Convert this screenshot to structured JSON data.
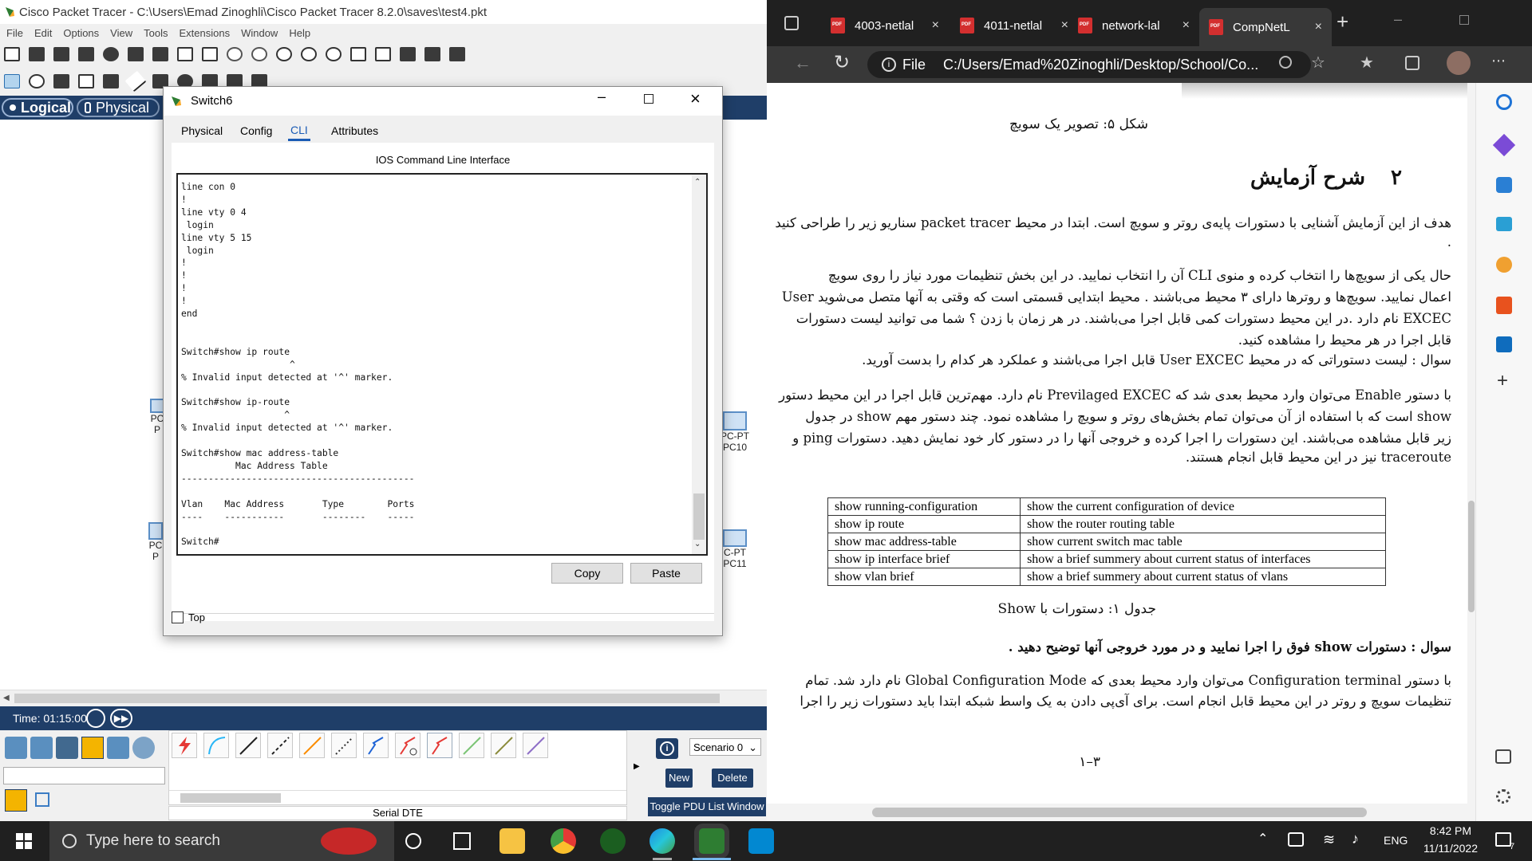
{
  "pt": {
    "title": "Cisco Packet Tracer - C:\\Users\\Emad Zinoghli\\Cisco Packet Tracer 8.2.0\\saves\\test4.pkt",
    "menu": [
      "File",
      "Edit",
      "Options",
      "View",
      "Tools",
      "Extensions",
      "Window",
      "Help"
    ],
    "view_tabs": {
      "logical": "Logical",
      "physical": "Physical"
    },
    "time_label": "Time: 01:15:00",
    "scenario": "Scenario 0",
    "new_button": "New",
    "delete_button": "Delete",
    "toggle_pdu": "Toggle PDU List Window",
    "connection_label": "Serial DTE",
    "devices": [
      {
        "label1": "PC",
        "label2": "P"
      },
      {
        "label1": "PC-PT",
        "label2": "PC10"
      },
      {
        "label1": "PC",
        "label2": "P"
      },
      {
        "label1": "C-PT",
        "label2": "PC11"
      }
    ]
  },
  "dialog": {
    "title": "Switch6",
    "tabs": [
      "Physical",
      "Config",
      "CLI",
      "Attributes"
    ],
    "active_tab": "CLI",
    "heading": "IOS Command Line Interface",
    "cli_text": "line con 0\n!\nline vty 0 4\n login\nline vty 5 15\n login\n!\n!\n!\n!\nend\n\n\nSwitch#show ip route\n                    ^\n% Invalid input detected at '^' marker.\n\nSwitch#show ip-route\n                   ^\n% Invalid input detected at '^' marker.\n\nSwitch#show mac address-table\n          Mac Address Table\n-------------------------------------------\n\nVlan    Mac Address       Type        Ports\n----    -----------       --------    -----\n\nSwitch#",
    "copy": "Copy",
    "paste": "Paste",
    "top_label": "Top"
  },
  "edge": {
    "tabs": [
      {
        "label": "4003-netlal"
      },
      {
        "label": "4011-netlal"
      },
      {
        "label": "network-lal"
      },
      {
        "label": "CompNetL"
      }
    ],
    "url_scheme": "File",
    "url": "C:/Users/Emad%20Zinoghli/Desktop/School/Co...",
    "pdf": {
      "figure_caption": "شکل ۵: تصویر یک سویچ",
      "section_number": "۲",
      "section_title": "شرح آزمایش",
      "p1_line1": "هدف از این آزمایش آشنایی با دستورات پایه‌ی روتر و سویچ است. ابتدا در محیط packet tracer سناریو زیر را طراحی کنید",
      "p1_line2": ".",
      "p2_line1": "حال یکی از سویچ‌ها را انتخاب کرده و منوی CLI آن را انتخاب نمایید.  در این بخش تنظیمات مورد نیاز را روی سویچ",
      "p2_line2": "اعمال نمایید. سویچ‌ها و روترها دارای ۳ محیط می‌باشند . محیط ابتدایی قسمتی است که وقتی به آنها متصل می‌شوید User",
      "p2_line3": "EXCEC نام دارد .در این محیط دستورات کمی قابل اجرا می‌باشند.  در هر زمان با زدن ؟ شما می توانید لیست دستورات",
      "p2_line4": "قابل اجرا در هر محیط را مشاهده کنید.",
      "p2_line5": "سوال : لیست دستوراتی که در محیط User EXCEC قابل اجرا می‌باشند و عملکرد هر کدام را بدست آورید.",
      "p3_line1": "با دستور Enable می‌توان وارد محیط بعدی شد که Previlaged EXCEC نام دارد. مهم‌ترین قابل اجرا در این محیط دستور",
      "p3_line2": "show است که با استفاده از آن می‌توان تمام بخش‌های روتر و سویچ را مشاهده نمود.  چند دستور مهم show در جدول",
      "p3_line3": "زیر قابل مشاهده می‌باشند.  این دستورات را اجرا کرده و خروجی آنها را در دستور کار خود نمایش دهید.  دستورات ping و",
      "p3_line4": "traceroute نیز در این محیط قابل انجام هستند.",
      "table": [
        [
          "show running-configuration",
          "show the current configuration of device"
        ],
        [
          "show ip route",
          "show the router routing table"
        ],
        [
          "show mac address-table",
          "show current switch mac table"
        ],
        [
          "show ip interface brief",
          "show a brief summery about current status of interfaces"
        ],
        [
          "show vlan brief",
          "show a brief summery about current status of vlans"
        ]
      ],
      "table_caption": "جدول ۱: دستورات با Show",
      "question": "سوال : دستورات show فوق را اجرا نمایید و در مورد خروجی آنها توضیح دهید .",
      "p4_line1": "با دستور Configuration terminal می‌توان وارد محیط بعدی که Global Configuration Mode نام دارد شد.  تمام",
      "p4_line2": "تنظیمات سویچ و روتر در این محیط قابل انجام است.  برای آی‌پی دادن به یک واسط شبکه ابتدا باید دستورات زیر را اجرا",
      "page_number": "۳–۱"
    }
  },
  "taskbar": {
    "search_placeholder": "Type here to search",
    "lang": "ENG",
    "time": "8:42 PM",
    "date": "11/11/2022",
    "notification_count": "7"
  },
  "colors": {
    "pt_navy": "#1f3e68",
    "edge_dark": "#202020",
    "edge_bar": "#383838",
    "pdf_red": "#d32f2f"
  }
}
